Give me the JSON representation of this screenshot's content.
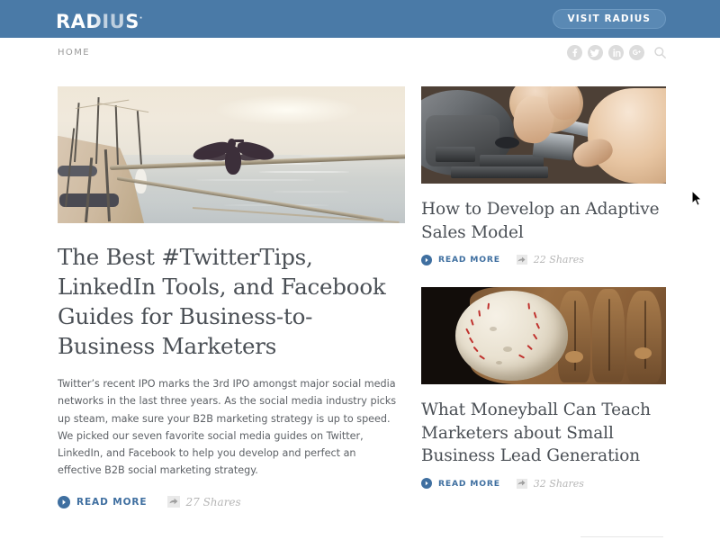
{
  "topbar": {
    "logo_main": "RADIUS",
    "logo_tm": "·",
    "visit_label": "VISIT RADIUS",
    "bg_color": "#4a7aa7",
    "button_color": "#5a89b4"
  },
  "nav": {
    "breadcrumb": "HOME",
    "social": [
      {
        "name": "facebook-icon",
        "label": "f"
      },
      {
        "name": "twitter-icon",
        "label": "t"
      },
      {
        "name": "linkedin-icon",
        "label": "in"
      },
      {
        "name": "googleplus-icon",
        "label": "g+"
      }
    ],
    "search_icon": "search-icon"
  },
  "featured": {
    "image_alt": "cormorant with spread wings perched on a harbour rope",
    "title": "The Best #TwitterTips, LinkedIn Tools, and Facebook Guides for Business-to-Business Marketers",
    "body": "Twitter’s recent IPO marks the 3rd IPO amongst major social media networks in the last three years. As the social media industry picks up steam, make sure your B2B marketing strategy is up to speed. We picked our seven favorite social media guides on Twitter, LinkedIn, and Facebook to help you develop and perfect an effective B2B social marketing strategy.",
    "read_more": "READ MORE",
    "shares": "27 Shares"
  },
  "side_articles": [
    {
      "image_alt": "hands measuring a metal part on a lathe with calipers",
      "title": "How to Develop an Adaptive Sales Model",
      "read_more": "READ MORE",
      "shares": "22 Shares"
    },
    {
      "image_alt": "weathered baseball resting in a leather glove",
      "title": "What Moneyball Can Teach Marketers about Small Business Lead Generation",
      "read_more": "READ MORE",
      "shares": "32 Shares"
    }
  ],
  "theme": {
    "link_blue": "#3f6fa0",
    "heading_gray": "#4a4f55",
    "body_gray": "#5d6166",
    "muted_gray": "#b6b6b6"
  }
}
